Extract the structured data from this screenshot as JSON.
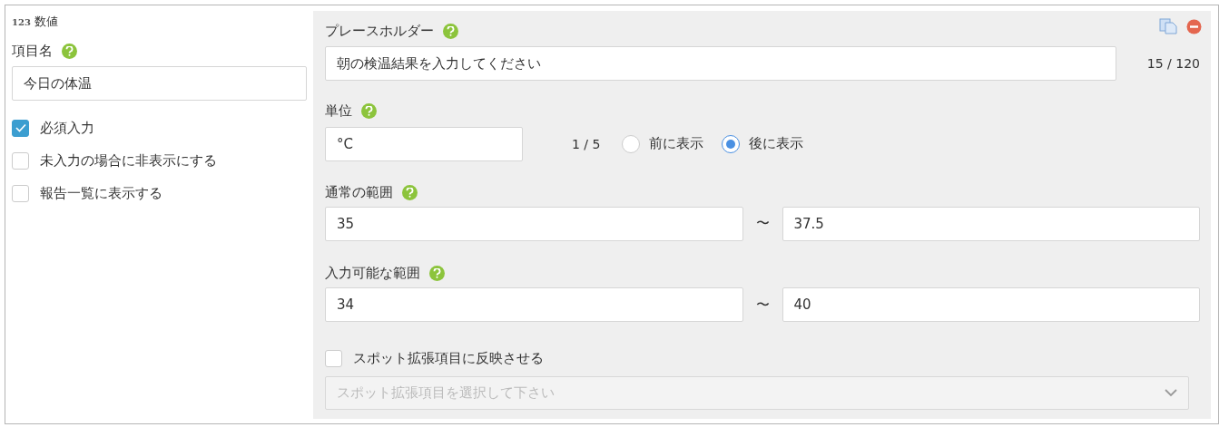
{
  "type_badge": {
    "icon_text": "123",
    "label": "数値"
  },
  "item_name": {
    "label": "項目名",
    "value": "今日の体温"
  },
  "options": [
    {
      "label": "必須入力",
      "checked": true
    },
    {
      "label": "未入力の場合に非表示にする",
      "checked": false
    },
    {
      "label": "報告一覧に表示する",
      "checked": false
    }
  ],
  "placeholder": {
    "label": "プレースホルダー",
    "value": "朝の検温結果を入力してください",
    "counter": "15 / 120"
  },
  "unit": {
    "label": "単位",
    "value": "°C",
    "counter": "1 / 5",
    "positions": [
      {
        "label": "前に表示",
        "selected": false
      },
      {
        "label": "後に表示",
        "selected": true
      }
    ]
  },
  "ranges": [
    {
      "label": "通常の範囲",
      "min": "35",
      "separator": "〜",
      "max": "37.5"
    },
    {
      "label": "入力可能な範囲",
      "min": "34",
      "separator": "〜",
      "max": "40"
    }
  ],
  "spot": {
    "label": "スポット拡張項目に反映させる",
    "checked": false,
    "select_placeholder": "スポット拡張項目を選択して下さい"
  }
}
